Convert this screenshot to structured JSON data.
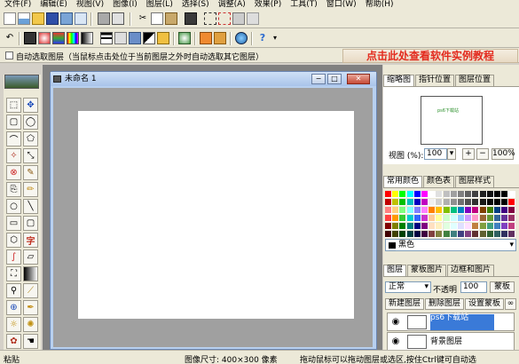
{
  "menu": [
    "文件(F)",
    "编辑(E)",
    "视图(V)",
    "图像(I)",
    "图层(L)",
    "选择(S)",
    "调整(A)",
    "效果(P)",
    "工具(T)",
    "窗口(W)",
    "帮助(H)"
  ],
  "options": {
    "auto_select_label": "自动选取图层（当鼠标点击处位于当前图层之外时自动选取其它图层）",
    "promo_text": "点击此处查看软件实例教程"
  },
  "document": {
    "title": "未命名 1",
    "minimize": "−",
    "restore": "□",
    "close": "✕"
  },
  "navigator": {
    "tabs": [
      "缩略图",
      "指针位置",
      "图层位置"
    ],
    "thumb_text": "ps6下载站",
    "zoom_label": "视图 (%):",
    "zoom_value": "100",
    "zoom_in": "+",
    "zoom_out": "−",
    "zoom_100": "100%"
  },
  "colors": {
    "tabs": [
      "常用颜色",
      "颜色表",
      "图层样式"
    ],
    "selected_name": "黑色",
    "palette": [
      [
        "#ff0000",
        "#ffff00",
        "#00ff00",
        "#00ffff",
        "#0000ff",
        "#ff00ff",
        "#ffffff",
        "#e0e0e0",
        "#c0c0c0",
        "#a0a0a0",
        "#808080",
        "#606060",
        "#404040",
        "#202020",
        "#101010",
        "#000000",
        "#000000",
        "#ffffff"
      ],
      [
        "#c00000",
        "#c0c000",
        "#00c000",
        "#00c0c0",
        "#0000c0",
        "#c000c0",
        "#f0f0f0",
        "#d0d0d0",
        "#b0b0b0",
        "#909090",
        "#707070",
        "#505050",
        "#303030",
        "#181818",
        "#080808",
        "#000000",
        "#000000",
        "#ff0000"
      ],
      [
        "#ff8080",
        "#ffd080",
        "#80ff80",
        "#80ffff",
        "#8080ff",
        "#ff80ff",
        "#ff8000",
        "#ffc000",
        "#80c000",
        "#00c080",
        "#0080c0",
        "#8000c0",
        "#c00080",
        "#804000",
        "#408000",
        "#004080",
        "#400080",
        "#800040"
      ],
      [
        "#ff4040",
        "#ff9900",
        "#33cc33",
        "#00cccc",
        "#3366ff",
        "#cc33cc",
        "#ffcc99",
        "#ffff99",
        "#ccffcc",
        "#ccffff",
        "#99ccff",
        "#cc99ff",
        "#ff99cc",
        "#996633",
        "#669933",
        "#336699",
        "#663399",
        "#993366"
      ],
      [
        "#800000",
        "#808000",
        "#008000",
        "#008080",
        "#000080",
        "#800080",
        "#ffe0c0",
        "#fff0c0",
        "#e0ffe0",
        "#e0ffff",
        "#e0e0ff",
        "#ffe0ff",
        "#c08040",
        "#80a040",
        "#40a080",
        "#4080c0",
        "#8040c0",
        "#c04080"
      ],
      [
        "#400000",
        "#404000",
        "#004000",
        "#004040",
        "#000040",
        "#400040",
        "#804040",
        "#808040",
        "#408040",
        "#408080",
        "#404080",
        "#804080",
        "#603030",
        "#606030",
        "#306030",
        "#306060",
        "#303060",
        "#603060"
      ]
    ]
  },
  "layers": {
    "tabs": [
      "图层",
      "蒙板图片",
      "边框和图片"
    ],
    "blend_mode": "正常",
    "opacity_label": "不透明",
    "opacity_value": "100",
    "mask_button": "蒙板",
    "new_layer": "新建图层",
    "delete_layer": "删除图层",
    "set_mask": "设置蒙板",
    "items": [
      {
        "name": "ps6下载站",
        "selected": true
      },
      {
        "name": "背景图层",
        "selected": false
      }
    ]
  },
  "status": {
    "left": "粘贴",
    "size": "图像尺寸: 400×300 像素",
    "hint": "拖动鼠标可以拖动图层或选区,按住Ctrl键可自动选"
  }
}
